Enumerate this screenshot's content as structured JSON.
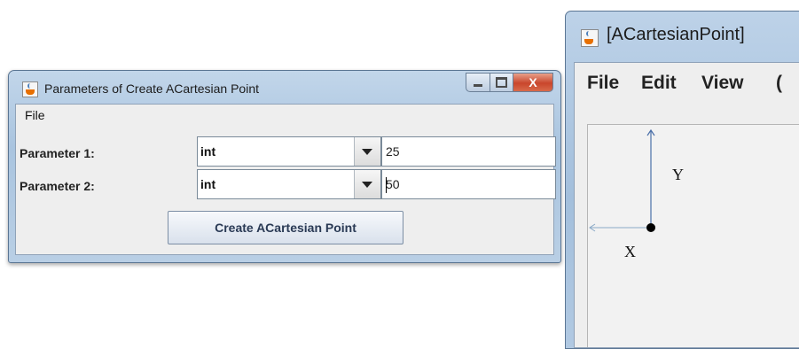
{
  "dialog": {
    "title": "Parameters of Create  ACartesian Point",
    "menu": [
      "File"
    ],
    "parameters": [
      {
        "label": "Parameter 1:",
        "type": "int",
        "value": "25"
      },
      {
        "label": "Parameter 2:",
        "type": "int",
        "value": "50"
      }
    ],
    "create_button": "Create  ACartesian Point",
    "controls": {
      "close_glyph": "X"
    }
  },
  "window2": {
    "title": "[ACartesianPoint]",
    "menu": [
      "File",
      "Edit",
      "View",
      "("
    ],
    "canvas": {
      "x_label": "X",
      "y_label": "Y"
    }
  },
  "colors": {
    "title_gradient": "#a9c4df",
    "close_button": "#c9462c",
    "point": "#000000",
    "axis_x": "#8aa9c7",
    "axis_y": "#4a6fa8"
  },
  "icons": [
    "java-icon",
    "minimize-icon",
    "maximize-icon",
    "close-icon",
    "dropdown-arrow-icon"
  ]
}
